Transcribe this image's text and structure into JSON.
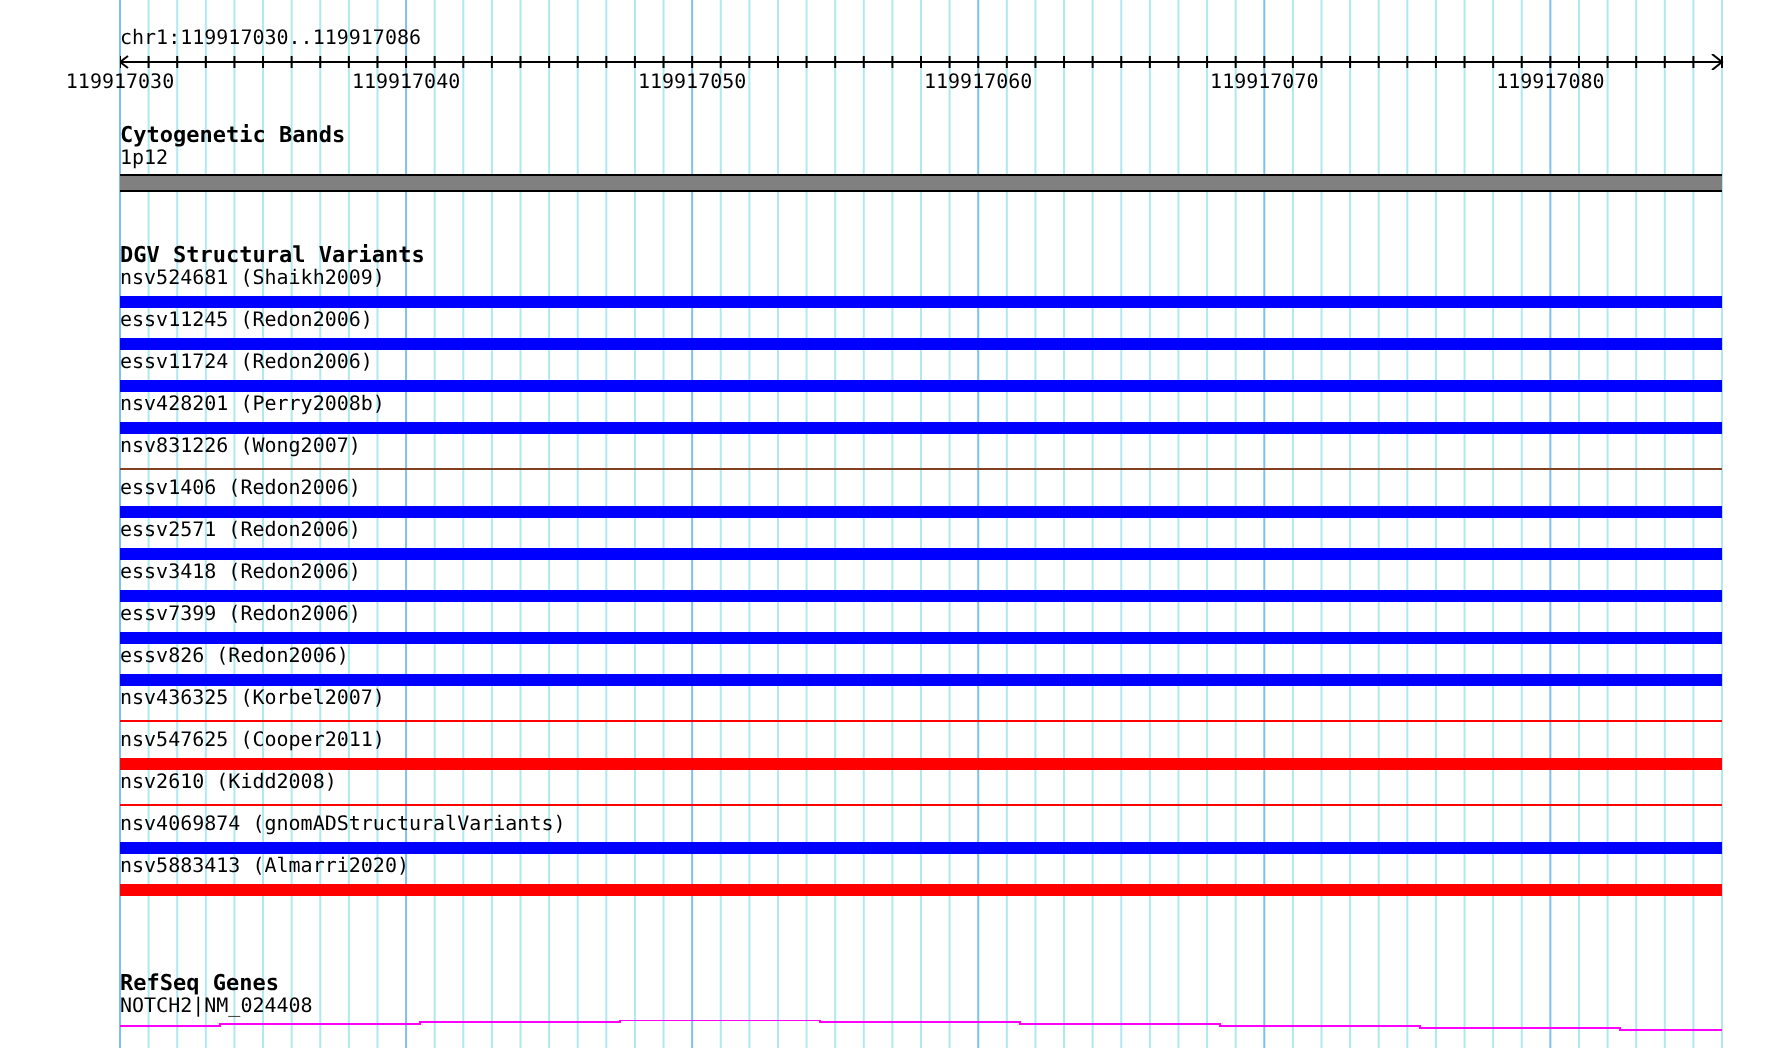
{
  "location": "chr1:119917030..119917086",
  "ruler": {
    "labels": [
      "119917030",
      "119917040",
      "119917050",
      "119917060",
      "119917070",
      "119917080"
    ]
  },
  "tracks": [
    {
      "kind": "band",
      "title": "Cytogenetic Bands",
      "features": [
        {
          "label": "1p12",
          "kind": "thick",
          "color": "#808080"
        }
      ]
    },
    {
      "kind": "variants",
      "title": "DGV Structural Variants",
      "features": [
        {
          "label": "nsv524681 (Shaikh2009)",
          "kind": "thick",
          "color": "#0000ff"
        },
        {
          "label": "essv11245 (Redon2006)",
          "kind": "thick",
          "color": "#0000ff"
        },
        {
          "label": "essv11724 (Redon2006)",
          "kind": "thick",
          "color": "#0000ff"
        },
        {
          "label": "nsv428201 (Perry2008b)",
          "kind": "thick",
          "color": "#0000ff"
        },
        {
          "label": "nsv831226 (Wong2007)",
          "kind": "thin",
          "color": "#804020"
        },
        {
          "label": "essv1406 (Redon2006)",
          "kind": "thick",
          "color": "#0000ff"
        },
        {
          "label": "essv2571 (Redon2006)",
          "kind": "thick",
          "color": "#0000ff"
        },
        {
          "label": "essv3418 (Redon2006)",
          "kind": "thick",
          "color": "#0000ff"
        },
        {
          "label": "essv7399 (Redon2006)",
          "kind": "thick",
          "color": "#0000ff"
        },
        {
          "label": "essv826 (Redon2006)",
          "kind": "thick",
          "color": "#0000ff"
        },
        {
          "label": "nsv436325 (Korbel2007)",
          "kind": "thin",
          "color": "#ff0000"
        },
        {
          "label": "nsv547625 (Cooper2011)",
          "kind": "thick",
          "color": "#ff0000"
        },
        {
          "label": "nsv2610 (Kidd2008)",
          "kind": "thin",
          "color": "#ff0000"
        },
        {
          "label": "nsv4069874 (gnomADStructuralVariants)",
          "kind": "thick",
          "color": "#0000ff"
        },
        {
          "label": "nsv5883413 (Almarri2020)",
          "kind": "thick",
          "color": "#ff0000"
        }
      ]
    },
    {
      "kind": "gene",
      "title": "RefSeq Genes",
      "features": [
        {
          "label": "NOTCH2|NM_024408",
          "kind": "gene",
          "color": "#ff00ff"
        }
      ]
    }
  ]
}
